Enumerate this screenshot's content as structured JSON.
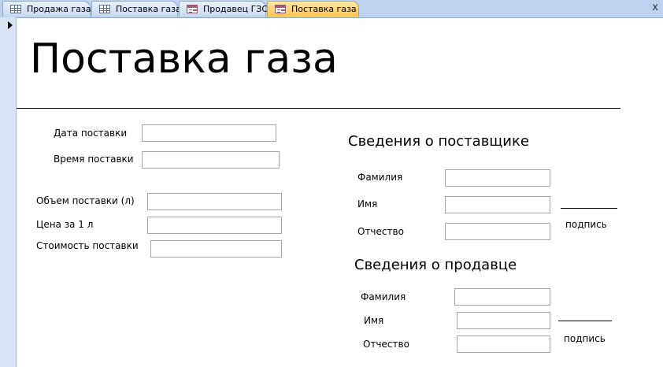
{
  "tabs": [
    {
      "label": "Продажа газа",
      "icon": "table-icon"
    },
    {
      "label": "Поставка газа",
      "icon": "table-icon"
    },
    {
      "label": "Продавец ГЗС",
      "icon": "form-icon"
    },
    {
      "label": "Поставка газа",
      "icon": "form-icon"
    }
  ],
  "close_glyph": "x",
  "form": {
    "title": "Поставка газа",
    "delivery": {
      "date_label": "Дата поставки",
      "time_label": "Время поставки",
      "volume_label": "Объем поставки (л)",
      "price_label": "Цена за 1 л",
      "cost_label": "Стоимость поставки",
      "date_value": "",
      "time_value": "",
      "volume_value": "",
      "price_value": "",
      "cost_value": ""
    },
    "supplier": {
      "heading": "Сведения о поставщике",
      "last_name_label": "Фамилия",
      "first_name_label": "Имя",
      "patronymic_label": "Отчество",
      "signature_label": "подпись",
      "last_name_value": "",
      "first_name_value": "",
      "patronymic_value": ""
    },
    "seller": {
      "heading": "Сведения о продавце",
      "last_name_label": "Фамилия",
      "first_name_label": "Имя",
      "patronymic_label": "Отчество",
      "signature_label": "подпись",
      "last_name_value": "",
      "first_name_value": "",
      "patronymic_value": ""
    }
  }
}
